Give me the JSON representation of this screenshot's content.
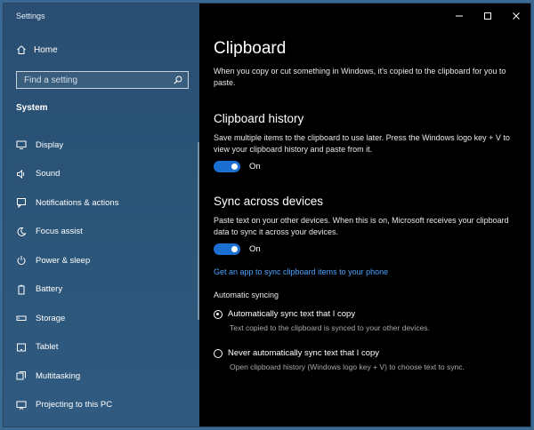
{
  "window": {
    "title": "Settings"
  },
  "sidebar": {
    "home_label": "Home",
    "search_placeholder": "Find a setting",
    "section_label": "System",
    "items": [
      {
        "label": "Display",
        "icon": "display-icon"
      },
      {
        "label": "Sound",
        "icon": "speaker-icon"
      },
      {
        "label": "Notifications & actions",
        "icon": "notification-icon"
      },
      {
        "label": "Focus assist",
        "icon": "moon-icon"
      },
      {
        "label": "Power & sleep",
        "icon": "power-icon"
      },
      {
        "label": "Battery",
        "icon": "battery-icon"
      },
      {
        "label": "Storage",
        "icon": "storage-icon"
      },
      {
        "label": "Tablet",
        "icon": "tablet-icon"
      },
      {
        "label": "Multitasking",
        "icon": "multitasking-icon"
      },
      {
        "label": "Projecting to this PC",
        "icon": "projector-icon"
      }
    ]
  },
  "main": {
    "title": "Clipboard",
    "intro": "When you copy or cut something in Windows, it's copied to the clipboard for you to paste.",
    "history": {
      "heading": "Clipboard history",
      "description": "Save multiple items to the clipboard to use later. Press the Windows logo key + V to view your clipboard history and paste from it.",
      "toggle_state": "On"
    },
    "sync": {
      "heading": "Sync across devices",
      "description": "Paste text on your other devices. When this is on, Microsoft receives your clipboard data to sync it across your devices.",
      "toggle_state": "On",
      "link": "Get an app to sync clipboard items to your phone",
      "auto_label": "Automatic syncing",
      "options": [
        {
          "label": "Automatically sync text that I copy",
          "description": "Text copied to the clipboard is synced to your other devices.",
          "checked": true
        },
        {
          "label": "Never automatically sync text that I copy",
          "description": "Open clipboard history (Windows logo key + V) to choose text to sync.",
          "checked": false
        }
      ]
    }
  },
  "colors": {
    "accent": "#1b6fd1",
    "link": "#4aa3ff",
    "sidebar": "#2b5477",
    "content_bg": "#000000"
  }
}
